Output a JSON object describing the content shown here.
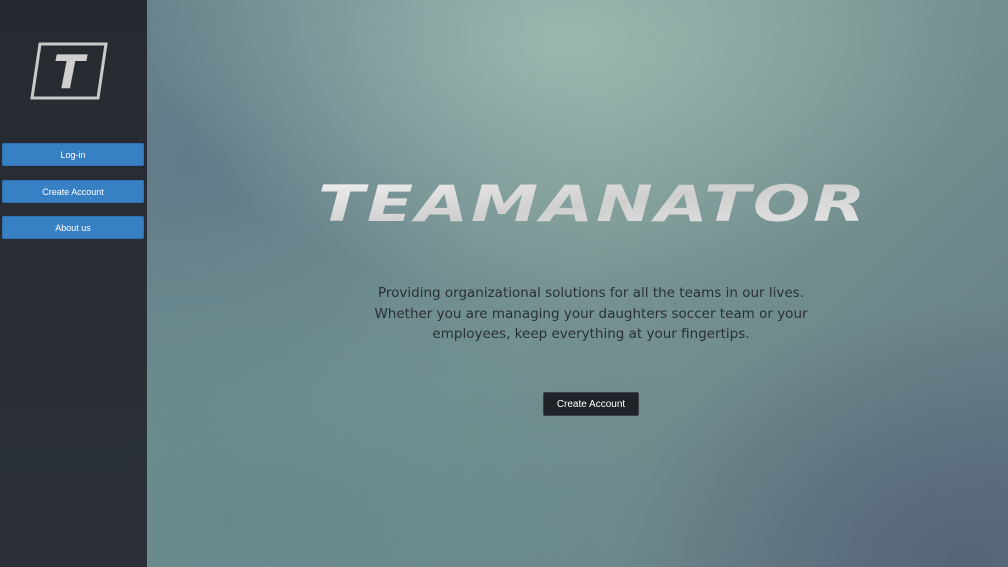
{
  "sidebar": {
    "logo_icon": "team-t-logo-icon",
    "logo_letter": "T",
    "items": [
      {
        "label": "Log-in"
      },
      {
        "label": "Create Account"
      },
      {
        "label": "About us"
      }
    ],
    "button_color": "#3880c4"
  },
  "main": {
    "brand": "TEAMANATOR",
    "tagline": [
      "Providing organizational solutions for all the teams in our lives.",
      "Whether you are managing your daughters soccer team or your",
      "employees, keep everything at your fingertips."
    ],
    "cta_label": "Create Account"
  }
}
